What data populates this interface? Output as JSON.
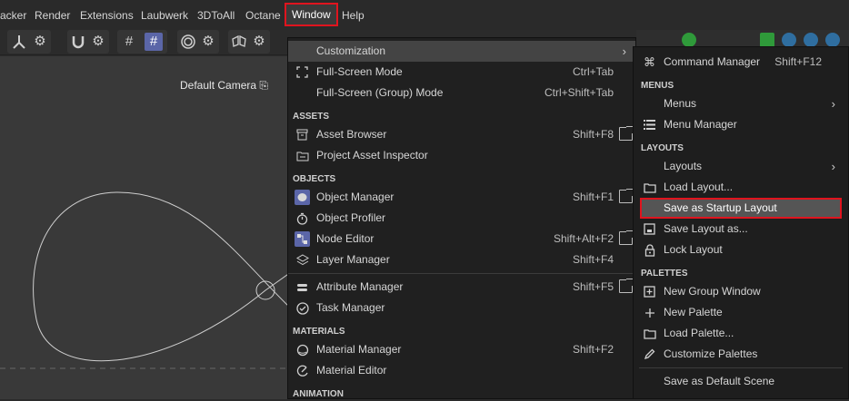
{
  "menubar": {
    "items": [
      {
        "label": "acker"
      },
      {
        "label": "Render"
      },
      {
        "label": "Extensions"
      },
      {
        "label": "Laubwerk"
      },
      {
        "label": "3DToAll"
      },
      {
        "label": "Octane"
      },
      {
        "label": "Window",
        "active": true
      },
      {
        "label": "Help"
      }
    ]
  },
  "toolbar": {
    "icons": [
      "axis-icon",
      "gear-icon",
      "magnet-icon",
      "gear-icon",
      "grid-snap-icon",
      "grid-snap-active-icon",
      "radial-icon",
      "gear-icon",
      "symmetry-icon",
      "gear-icon"
    ]
  },
  "viewport": {
    "camera_label": "Default Camera",
    "camera_glyph": "⎘"
  },
  "window_menu": {
    "items": [
      {
        "label": "Customization",
        "arrow": "›",
        "highlighted": true
      },
      {
        "label": "Full-Screen Mode",
        "shortcut": "Ctrl+Tab",
        "icon": "fullscreen-icon"
      },
      {
        "label": "Full-Screen (Group) Mode",
        "shortcut": "Ctrl+Shift+Tab"
      },
      {
        "section": "ASSETS"
      },
      {
        "label": "Asset Browser",
        "shortcut": "Shift+F8",
        "icon": "asset-browser-icon",
        "external": true
      },
      {
        "label": "Project Asset Inspector",
        "icon": "folder-icon"
      },
      {
        "section": "OBJECTS"
      },
      {
        "label": "Object Manager",
        "shortcut": "Shift+F1",
        "icon": "object-manager-icon",
        "external": true
      },
      {
        "label": "Object Profiler",
        "icon": "stopwatch-icon"
      },
      {
        "label": "Node Editor",
        "shortcut": "Shift+Alt+F2",
        "icon": "node-editor-icon",
        "external": true
      },
      {
        "label": "Layer Manager",
        "shortcut": "Shift+F4",
        "icon": "layers-icon"
      },
      {
        "separator": true
      },
      {
        "label": "Attribute Manager",
        "shortcut": "Shift+F5",
        "icon": "attribute-icon",
        "external": true
      },
      {
        "label": "Task Manager",
        "icon": "check-circle-icon"
      },
      {
        "section": "MATERIALS"
      },
      {
        "label": "Material Manager",
        "shortcut": "Shift+F2",
        "icon": "material-icon"
      },
      {
        "label": "Material Editor",
        "icon": "material-editor-icon"
      },
      {
        "section": "ANIMATION"
      }
    ]
  },
  "customization_menu": {
    "items": [
      {
        "label": "Command Manager",
        "shortcut": "Shift+F12",
        "icon": "command-icon"
      },
      {
        "section": "MENUS"
      },
      {
        "label": "Menus",
        "arrow": "›"
      },
      {
        "label": "Menu Manager",
        "icon": "menu-manager-icon"
      },
      {
        "section": "LAYOUTS"
      },
      {
        "label": "Layouts",
        "arrow": "›"
      },
      {
        "label": "Load Layout...",
        "icon": "folder-icon"
      },
      {
        "label": "Save as Startup Layout",
        "highlighted": true
      },
      {
        "label": "Save Layout as...",
        "icon": "save-icon"
      },
      {
        "label": "Lock Layout",
        "icon": "lock-icon"
      },
      {
        "section": "PALETTES"
      },
      {
        "label": "New Group Window",
        "icon": "group-window-icon"
      },
      {
        "label": "New Palette",
        "icon": "plus-icon"
      },
      {
        "label": "Load Palette...",
        "icon": "folder-icon"
      },
      {
        "label": "Customize Palettes",
        "icon": "pencil-icon"
      },
      {
        "separator": true
      },
      {
        "label": "Save as Default Scene"
      }
    ]
  },
  "colors": {
    "highlight_border": "#e0141e",
    "accent": "#5b66a8",
    "menu_bg": "#202020"
  }
}
